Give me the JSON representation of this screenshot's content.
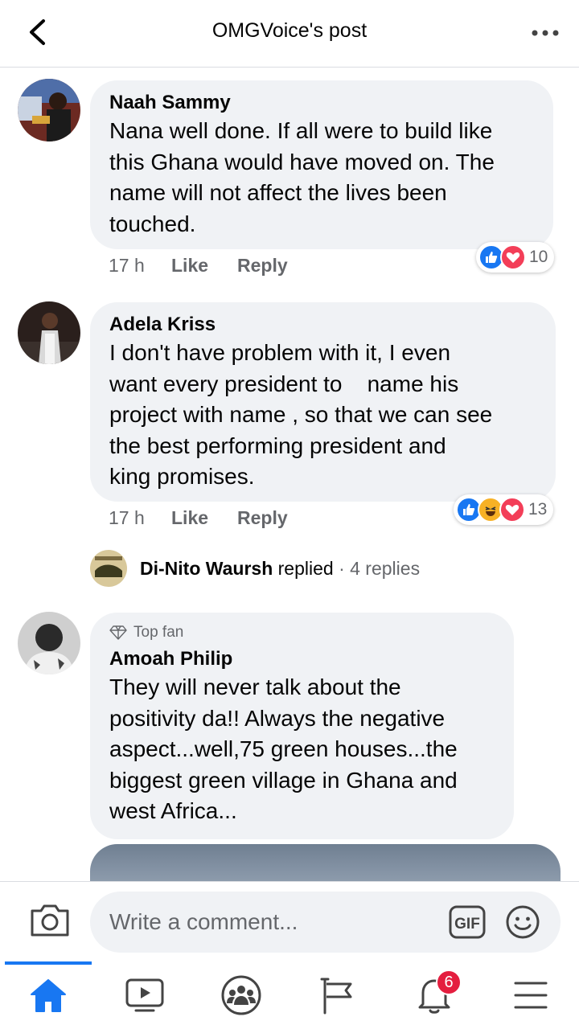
{
  "header": {
    "title": "OMGVoice's post"
  },
  "comments": [
    {
      "author": "Naah Sammy",
      "text": "Nana well done. If all were to build like\nthis Ghana would have moved on. The\nname will not affect the lives been\ntouched.",
      "time": "17 h",
      "like_label": "Like",
      "reply_label": "Reply",
      "reactions": [
        "like",
        "love"
      ],
      "reaction_count": "10"
    },
    {
      "author": "Adela Kriss",
      "text": "I don't have problem with it, I even\nwant every president to    name his\nproject with name , so that we can see\nthe best performing president and\nking promises.",
      "time": "17 h",
      "like_label": "Like",
      "reply_label": "Reply",
      "reactions": [
        "like",
        "haha",
        "love"
      ],
      "reaction_count": "13",
      "replies": {
        "name": "Di-Nito Waursh",
        "action": "replied",
        "count": "· 4 replies"
      }
    },
    {
      "badge": "Top fan",
      "author": "Amoah Philip",
      "text": "They will never talk about the\npositivity da!! Always the negative\naspect...well,75 green houses...the\nbiggest green village in Ghana and\nwest Africa..."
    }
  ],
  "composer": {
    "placeholder": "Write a comment...",
    "gif_label": "GIF"
  },
  "nav": {
    "items": [
      "home-icon",
      "watch-icon",
      "groups-icon",
      "pages-icon",
      "notifications-icon",
      "menu-icon"
    ],
    "notifications_badge": "6",
    "active": "home"
  },
  "colors": {
    "accent": "#1877f2",
    "bubble": "#f0f2f5",
    "muted": "#65676b",
    "badge": "#e41e3f"
  }
}
